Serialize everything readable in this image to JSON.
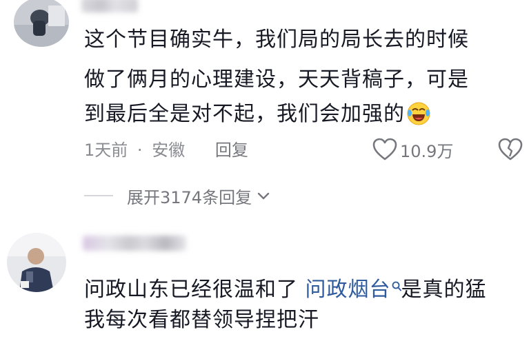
{
  "comment1": {
    "lines": [
      "这个节目确实牛，我们局的局长去的时候",
      "做了俩月的心理建设，天天背稿子，可是",
      "到最后全是对不起，我们会加强的"
    ],
    "emoji_icon": "laugh-cry-emoji-icon",
    "time": "1天前",
    "separator": "·",
    "location": "安徽",
    "reply_label": "回复",
    "like_count": "10.9万",
    "expand_label": "展开3174条回复"
  },
  "comment2": {
    "line1_prefix": "问政山东已经很温和了 ",
    "line1_link": "问政烟台",
    "line1_suffix": "是真的猛",
    "line2": "我每次看都替领导捏把汗"
  },
  "colors": {
    "text": "#161823",
    "meta": "#8a8b91",
    "link": "#2e5a9e",
    "background": "#ffffff"
  }
}
